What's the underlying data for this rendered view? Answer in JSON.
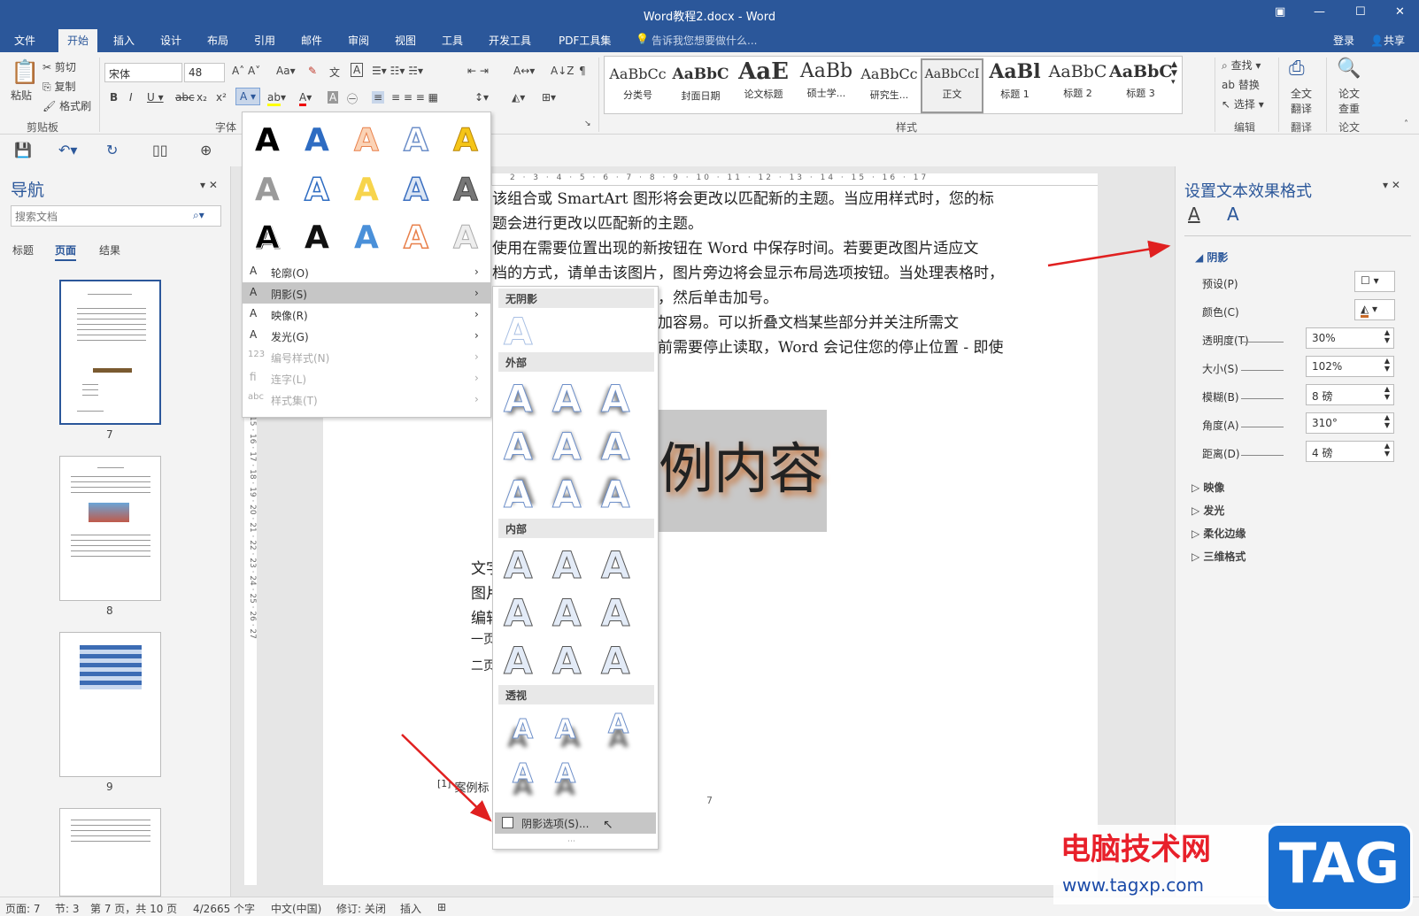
{
  "window": {
    "title": "Word教程2.docx - Word"
  },
  "tabs": [
    "文件",
    "开始",
    "插入",
    "设计",
    "布局",
    "引用",
    "邮件",
    "审阅",
    "视图",
    "工具",
    "开发工具",
    "PDF工具集"
  ],
  "tell_me": "告诉我您想要做什么...",
  "login": "登录",
  "share": "共享",
  "clipboard": {
    "paste": "粘贴",
    "cut": "剪切",
    "copy": "复制",
    "format_painter": "格式刷",
    "group": "剪贴板"
  },
  "font": {
    "name": "宋体",
    "size": "48",
    "group": "字体"
  },
  "styles": {
    "group": "样式",
    "items": [
      {
        "preview": "AaBbCc",
        "name": "分类号"
      },
      {
        "preview": "AaBbC",
        "name": "封面日期"
      },
      {
        "preview": "AaE",
        "name": "论文标题"
      },
      {
        "preview": "AaBb",
        "name": "硕士学..."
      },
      {
        "preview": "AaBbCc",
        "name": "研究生..."
      },
      {
        "preview": "AaBbCcI",
        "name": "正文"
      },
      {
        "preview": "AaBl",
        "name": "标题 1"
      },
      {
        "preview": "AaBbC",
        "name": "标题 2"
      },
      {
        "preview": "AaBbC",
        "name": "标题 3"
      }
    ]
  },
  "editing": {
    "find": "查找",
    "replace": "替换",
    "select": "选择",
    "group": "编辑"
  },
  "translate": {
    "full": "全文",
    "full2": "翻译",
    "group": "翻译"
  },
  "paper": {
    "check": "论文",
    "check2": "查重",
    "group": "论文"
  },
  "nav": {
    "title": "导航",
    "search_placeholder": "搜索文档",
    "tabs": [
      "标题",
      "页面",
      "结果"
    ],
    "page_numbers": [
      "7",
      "8",
      "9"
    ]
  },
  "effects_menu": {
    "items": [
      "轮廓(O)",
      "阴影(S)",
      "映像(R)",
      "发光(G)",
      "编号样式(N)",
      "连字(L)",
      "样式集(T)"
    ]
  },
  "shadow_menu": {
    "headers": [
      "无阴影",
      "外部",
      "内部",
      "透视"
    ],
    "options": "阴影选项(S)..."
  },
  "document": {
    "lines": [
      "该组合或 SmartArt 图形将会更改以匹配新的主题。当应用样式时，您的标",
      "题会进行更改以匹配新的主题。",
      "使用在需要位置出现的新按钮在 Word 中保存时间。若要更改图片适应文",
      "档的方式，请单击该图片，图片旁边将会显示布局选项按钮。当处理表格时，",
      "单击要添加行或列的位置，然后单击加号。",
      "在新的阅读视图中阅读更加容易。可以折叠文档某些部分并关注所需文",
      "本。如果在达到结尾处之前需要停止读取，Word 会记住您的停止位置 - 即使"
    ],
    "big_text": "例内容",
    "left_col": [
      "文字",
      "图片",
      "编辑",
      "一页",
      "二页"
    ],
    "footnote": "案例标",
    "page_number": "7"
  },
  "format_panel": {
    "title": "设置文本效果格式",
    "section": "阴影",
    "preset": "预设(P)",
    "color": "颜色(C)",
    "transparency": "透明度(T)",
    "transparency_val": "30%",
    "size": "大小(S)",
    "size_val": "102%",
    "blur": "模糊(B)",
    "blur_val": "8 磅",
    "angle": "角度(A)",
    "angle_val": "310°",
    "distance": "距离(D)",
    "distance_val": "4 磅",
    "others": [
      "映像",
      "发光",
      "柔化边缘",
      "三维格式"
    ]
  },
  "status": {
    "page": "页面: 7",
    "section": "节: 3",
    "pages": "第 7 页，共 10 页",
    "words": "4/2665 个字",
    "lang": "中文(中国)",
    "revision": "修订: 关闭",
    "insert": "插入"
  },
  "watermark": {
    "site": "电脑技术网",
    "url": "www.tagxp.com",
    "logo": "TAG"
  }
}
